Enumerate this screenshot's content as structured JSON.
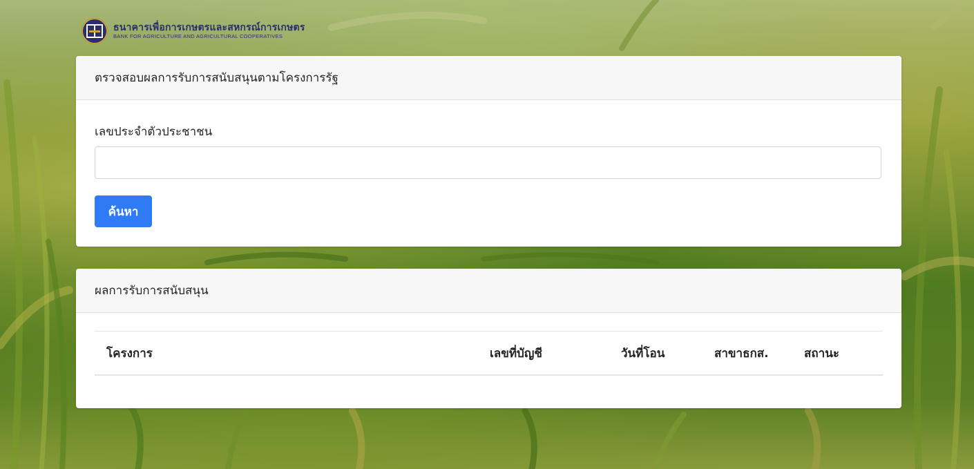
{
  "logo": {
    "thai_name": "ธนาคารเพื่อการเกษตรและสหกรณ์การเกษตร",
    "english_name": "BANK FOR AGRICULTURE AND AGRICULTURAL COOPERATIVES"
  },
  "search_card": {
    "header": "ตรวจสอบผลการรับการสนับสนุนตามโครงการรัฐ",
    "id_label": "เลขประจำตัวประชาชน",
    "id_value": "",
    "search_button": "ค้นหา"
  },
  "result_card": {
    "header": "ผลการรับการสนับสนุน",
    "columns": [
      "โครงการ",
      "เลขที่บัญชี",
      "วันที่โอน",
      "สาขาธกส.",
      "สถานะ"
    ],
    "rows": []
  },
  "colors": {
    "primary_button": "#2f7bf5",
    "brand_navy": "#2a2e6e",
    "brand_gold": "#c9a43a"
  },
  "icons": {
    "logo": "baac-logo-icon"
  }
}
